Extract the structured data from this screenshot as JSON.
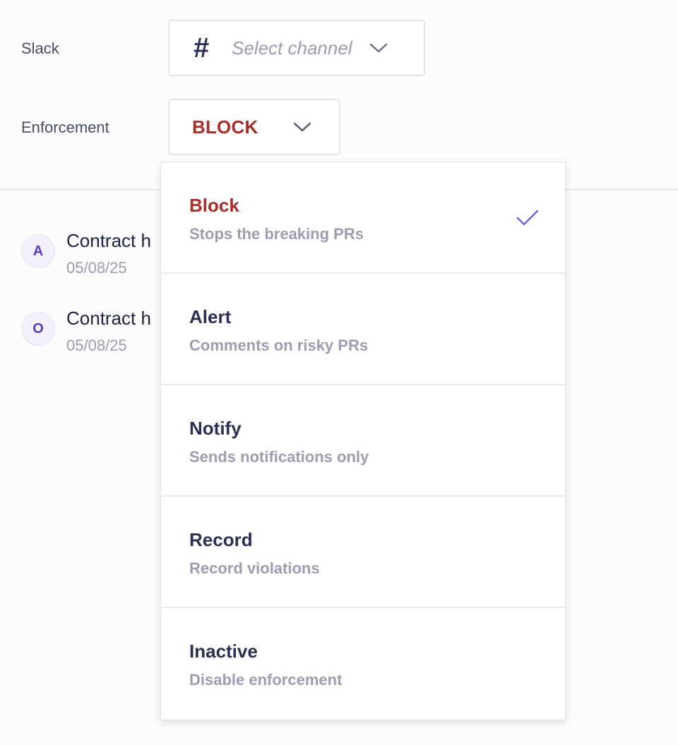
{
  "slack": {
    "label": "Slack",
    "icon": "hash-icon",
    "hash_glyph": "#",
    "placeholder": "Select channel"
  },
  "enforcement": {
    "label": "Enforcement",
    "value": "BLOCK",
    "value_color": "#a62d28"
  },
  "activity": [
    {
      "avatar": "A",
      "title": "Contract h",
      "date": "05/08/25"
    },
    {
      "avatar": "O",
      "title": "Contract h",
      "date": "05/08/25"
    }
  ],
  "menu": {
    "options": [
      {
        "title": "Block",
        "description": "Stops the breaking PRs",
        "selected": true
      },
      {
        "title": "Alert",
        "description": "Comments on risky PRs",
        "selected": false
      },
      {
        "title": "Notify",
        "description": "Sends notifications only",
        "selected": false
      },
      {
        "title": "Record",
        "description": "Record violations",
        "selected": false
      },
      {
        "title": "Inactive",
        "description": "Disable enforcement",
        "selected": false
      }
    ],
    "check_color": "#7b61e0"
  }
}
